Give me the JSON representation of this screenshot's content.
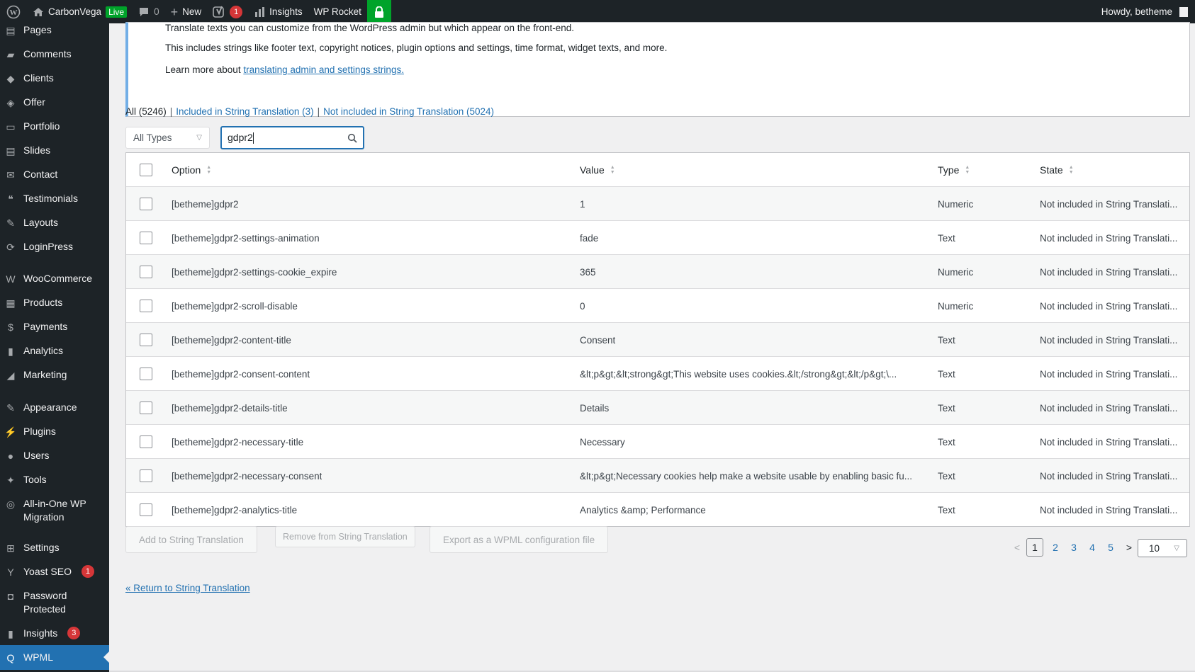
{
  "adminbar": {
    "site_name": "CarbonVega",
    "live_label": "Live",
    "comments_count": "0",
    "new_label": "New",
    "yoast_count": "1",
    "insights_label": "Insights",
    "wprocket_label": "WP Rocket",
    "howdy": "Howdy, betheme"
  },
  "sidebar": {
    "items": [
      {
        "label": "Pages",
        "icon": "pages-icon"
      },
      {
        "label": "Comments",
        "icon": "comments-icon"
      },
      {
        "label": "Clients",
        "icon": "clients-icon"
      },
      {
        "label": "Offer",
        "icon": "offer-icon"
      },
      {
        "label": "Portfolio",
        "icon": "portfolio-icon"
      },
      {
        "label": "Slides",
        "icon": "slides-icon"
      },
      {
        "label": "Contact",
        "icon": "contact-icon"
      },
      {
        "label": "Testimonials",
        "icon": "testimonials-icon"
      },
      {
        "label": "Layouts",
        "icon": "layouts-icon"
      },
      {
        "label": "LoginPress",
        "icon": "loginpress-icon"
      },
      {
        "label": "WooCommerce",
        "icon": "woocommerce-icon"
      },
      {
        "label": "Products",
        "icon": "products-icon"
      },
      {
        "label": "Payments",
        "icon": "payments-icon"
      },
      {
        "label": "Analytics",
        "icon": "analytics-icon"
      },
      {
        "label": "Marketing",
        "icon": "marketing-icon"
      },
      {
        "label": "Appearance",
        "icon": "appearance-icon"
      },
      {
        "label": "Plugins",
        "icon": "plugins-icon"
      },
      {
        "label": "Users",
        "icon": "users-icon"
      },
      {
        "label": "Tools",
        "icon": "tools-icon"
      },
      {
        "label": "All-in-One WP",
        "label2": "Migration",
        "icon": "migration-icon"
      },
      {
        "label": "Settings",
        "icon": "settings-icon"
      },
      {
        "label": "Yoast SEO",
        "badge": "1",
        "icon": "yoast-icon"
      },
      {
        "label": "Password",
        "label2": "Protected",
        "icon": "lock-icon"
      },
      {
        "label": "Insights",
        "badge": "3",
        "icon": "insights-icon"
      },
      {
        "label": "WPML",
        "icon": "wpml-icon",
        "current": true
      }
    ]
  },
  "notice": {
    "line1": "Translate texts you can customize from the WordPress admin but which appear on the front-end.",
    "line2": "This includes strings like footer text, copyright notices, plugin options and settings, time format, widget texts, and more.",
    "line3_prefix": "Learn more about ",
    "line3_link": "translating admin and settings strings."
  },
  "filters": {
    "all": "All (5246)",
    "included": "Included in String Translation (3)",
    "not_included": "Not included in String Translation (5024)",
    "separator": "|"
  },
  "type_select": {
    "value": "All Types"
  },
  "search": {
    "value": "gdpr2"
  },
  "table": {
    "headers": {
      "option": "Option",
      "value": "Value",
      "type": "Type",
      "state": "State"
    },
    "rows": [
      {
        "option": "[betheme]gdpr2",
        "value": "1",
        "type": "Numeric",
        "state": "Not included in String Translati..."
      },
      {
        "option": "[betheme]gdpr2-settings-animation",
        "value": "fade",
        "type": "Text",
        "state": "Not included in String Translati..."
      },
      {
        "option": "[betheme]gdpr2-settings-cookie_expire",
        "value": "365",
        "type": "Numeric",
        "state": "Not included in String Translati..."
      },
      {
        "option": "[betheme]gdpr2-scroll-disable",
        "value": "0",
        "type": "Numeric",
        "state": "Not included in String Translati..."
      },
      {
        "option": "[betheme]gdpr2-content-title",
        "value": "Consent",
        "type": "Text",
        "state": "Not included in String Translati..."
      },
      {
        "option": "[betheme]gdpr2-consent-content",
        "value": "&lt;p&gt;&lt;strong&gt;This website uses cookies.&lt;/strong&gt;&lt;/p&gt;\\...",
        "type": "Text",
        "state": "Not included in String Translati..."
      },
      {
        "option": "[betheme]gdpr2-details-title",
        "value": "Details",
        "type": "Text",
        "state": "Not included in String Translati..."
      },
      {
        "option": "[betheme]gdpr2-necessary-title",
        "value": "Necessary",
        "type": "Text",
        "state": "Not included in String Translati..."
      },
      {
        "option": "[betheme]gdpr2-necessary-consent",
        "value": "&lt;p&gt;Necessary cookies help make a website usable by enabling basic fu...",
        "type": "Text",
        "state": "Not included in String Translati..."
      },
      {
        "option": "[betheme]gdpr2-analytics-title",
        "value": "Analytics &amp; Performance",
        "type": "Text",
        "state": "Not included in String Translati..."
      }
    ]
  },
  "actions": {
    "add": "Add to String Translation",
    "remove": "Remove from String Translation",
    "export": "Export as a WPML configuration file"
  },
  "pagination": {
    "prev": "<",
    "next": ">",
    "pages": [
      "1",
      "2",
      "3",
      "4",
      "5"
    ],
    "current": "1",
    "per_page": "10"
  },
  "return_link": "« Return to String Translation",
  "colors": {
    "accent": "#2271b1",
    "adminbar": "#1d2327",
    "live": "#00a32a",
    "badge": "#d63638"
  }
}
